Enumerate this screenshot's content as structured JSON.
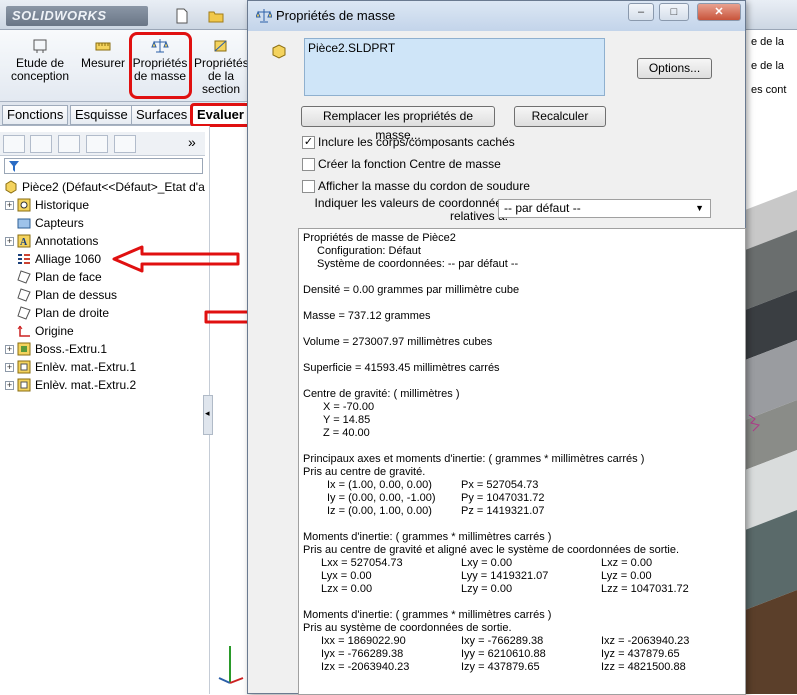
{
  "app": {
    "logo_text": "SOLIDWORKS",
    "ribbon": {
      "etude": "Etude de\nconception",
      "mesurer": "Mesurer",
      "proprietes_masse": "Propriétés\nde masse",
      "proprietes_section": "Propriétés\nde la\nsection"
    },
    "tabs": [
      "Fonctions",
      "Esquisse",
      "Surfaces",
      "Evaluer"
    ],
    "tree": {
      "root": "Pièce2  (Défaut<<Défaut>_Etat d'a",
      "items": [
        "Historique",
        "Capteurs",
        "Annotations",
        "Alliage 1060",
        "Plan de face",
        "Plan de dessus",
        "Plan de droite",
        "Origine",
        "Boss.-Extru.1",
        "Enlèv. mat.-Extru.1",
        "Enlèv. mat.-Extru.2"
      ]
    },
    "right_text": [
      "e de la",
      "e de la",
      "es cont"
    ]
  },
  "dialog": {
    "title": "Propriétés de masse",
    "file_item": "Pièce2.SLDPRT",
    "options_button": "Options...",
    "replace_button": "Remplacer les propriétés de masse...",
    "recalc_button": "Recalculer",
    "chk_include": "Inclure les corps/composants cachés",
    "chk_include_checked": true,
    "chk_centre": "Créer la fonction Centre de masse",
    "chk_soudure": "Afficher la masse du cordon de soudure",
    "coord_label": "Indiquer les valeurs de coordonnées relatives à:",
    "coord_value": "-- par défaut --",
    "results": {
      "header1": "Propriétés de masse de Pièce2",
      "header2": "Configuration: Défaut",
      "header3": "Système de coordonnées: -- par défaut --",
      "densite": "Densité = 0.00 grammes par millimètre cube",
      "masse": "Masse = 737.12 grammes",
      "volume": "Volume = 273007.97 millimètres cubes",
      "superficie": "Superficie = 41593.45  millimètres carrés",
      "cg_title": "Centre de gravité: ( millimètres )",
      "cg_x": "X = -70.00",
      "cg_y": "Y = 14.85",
      "cg_z": "Z = 40.00",
      "axes_title": "Principaux axes et moments d'inertie: ( grammes *  millimètres carrés )",
      "axes_sub": "Pris au centre de gravité.",
      "ix": "Ix = (1.00, 0.00, 0.00)",
      "iy": "Iy = (0.00, 0.00, -1.00)",
      "iz": "Iz = (0.00, 1.00, 0.00)",
      "px": "Px = 527054.73",
      "py": "Py = 1047031.72",
      "pz": "Pz = 1419321.07",
      "mi1_title": "Moments d'inertie: ( grammes *  millimètres carrés )",
      "mi1_sub": "Pris au centre de gravité et aligné avec le système de coordonnées de sortie.",
      "lxx": "Lxx = 527054.73",
      "lxy": "Lxy = 0.00",
      "lxz": "Lxz = 0.00",
      "lyx": "Lyx = 0.00",
      "lyy": "Lyy = 1419321.07",
      "lyz": "Lyz = 0.00",
      "lzx": "Lzx = 0.00",
      "lzy": "Lzy = 0.00",
      "lzz": "Lzz = 1047031.72",
      "mi2_title": "Moments d'inertie: ( grammes *  millimètres carrés )",
      "mi2_sub": "Pris au système de coordonnées de sortie.",
      "ixx": "Ixx = 1869022.90",
      "ixy": "Ixy = -766289.38",
      "ixz": "Ixz = -2063940.23",
      "iyx": "Iyx = -766289.38",
      "iyy": "Iyy = 6210610.88",
      "iyz": "Iyz = 437879.65",
      "izx": "Izx = -2063940.23",
      "izy": "Izy = 437879.65",
      "izz": "Izz = 4821500.88"
    }
  },
  "colors": {
    "annotation_red": "#e01010",
    "selection_blue": "#cfe5f8"
  }
}
